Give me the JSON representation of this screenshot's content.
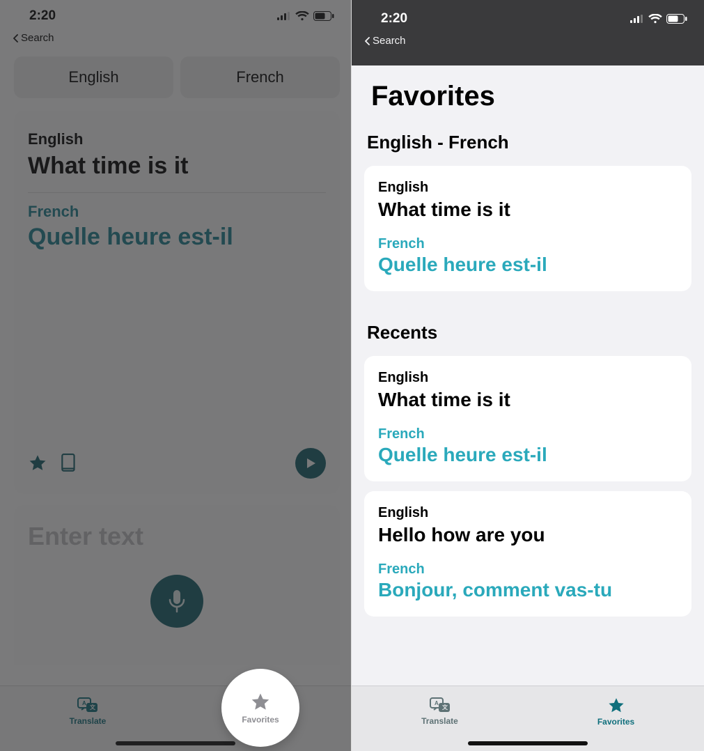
{
  "status": {
    "time": "2:20",
    "back_label": "Search"
  },
  "left": {
    "lang_from": "English",
    "lang_to": "French",
    "card": {
      "src_lang": "English",
      "src_text": "What time is it",
      "tgt_lang": "French",
      "tgt_text": "Quelle heure est-il"
    },
    "input_placeholder": "Enter text",
    "tabs": {
      "translate": "Translate",
      "favorites": "Favorites"
    }
  },
  "right": {
    "title": "Favorites",
    "pair_heading": "English - French",
    "favorites": [
      {
        "src_lang": "English",
        "src_text": "What time is it",
        "tgt_lang": "French",
        "tgt_text": "Quelle heure est-il"
      }
    ],
    "recents_heading": "Recents",
    "recents": [
      {
        "src_lang": "English",
        "src_text": "What time is it",
        "tgt_lang": "French",
        "tgt_text": "Quelle heure est-il"
      },
      {
        "src_lang": "English",
        "src_text": "Hello how are you",
        "tgt_lang": "French",
        "tgt_text": "Bonjour, comment vas-tu"
      }
    ],
    "tabs": {
      "translate": "Translate",
      "favorites": "Favorites"
    }
  }
}
